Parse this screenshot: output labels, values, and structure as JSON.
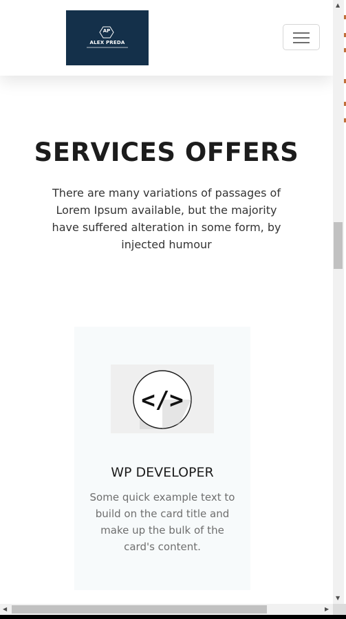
{
  "header": {
    "logo": {
      "initials": "AP",
      "name": "ALEX PREDA",
      "background": "#14304a"
    },
    "menu_icon": "hamburger-menu-icon"
  },
  "services": {
    "title": "SERVICES OFFERS",
    "description": "There are many variations of passages of Lorem Ipsum available, but the majority have suffered alteration in some form, by injected humour",
    "cards": [
      {
        "icon": "code-icon",
        "icon_glyph": "</>",
        "title": "WP DEVELOPER",
        "text": "Some quick example text to build on the card title and make up the bulk of the card's content."
      }
    ]
  },
  "scrollbars": {
    "up_arrow": "▲",
    "down_arrow": "▼",
    "left_arrow": "◀",
    "right_arrow": "▶"
  }
}
